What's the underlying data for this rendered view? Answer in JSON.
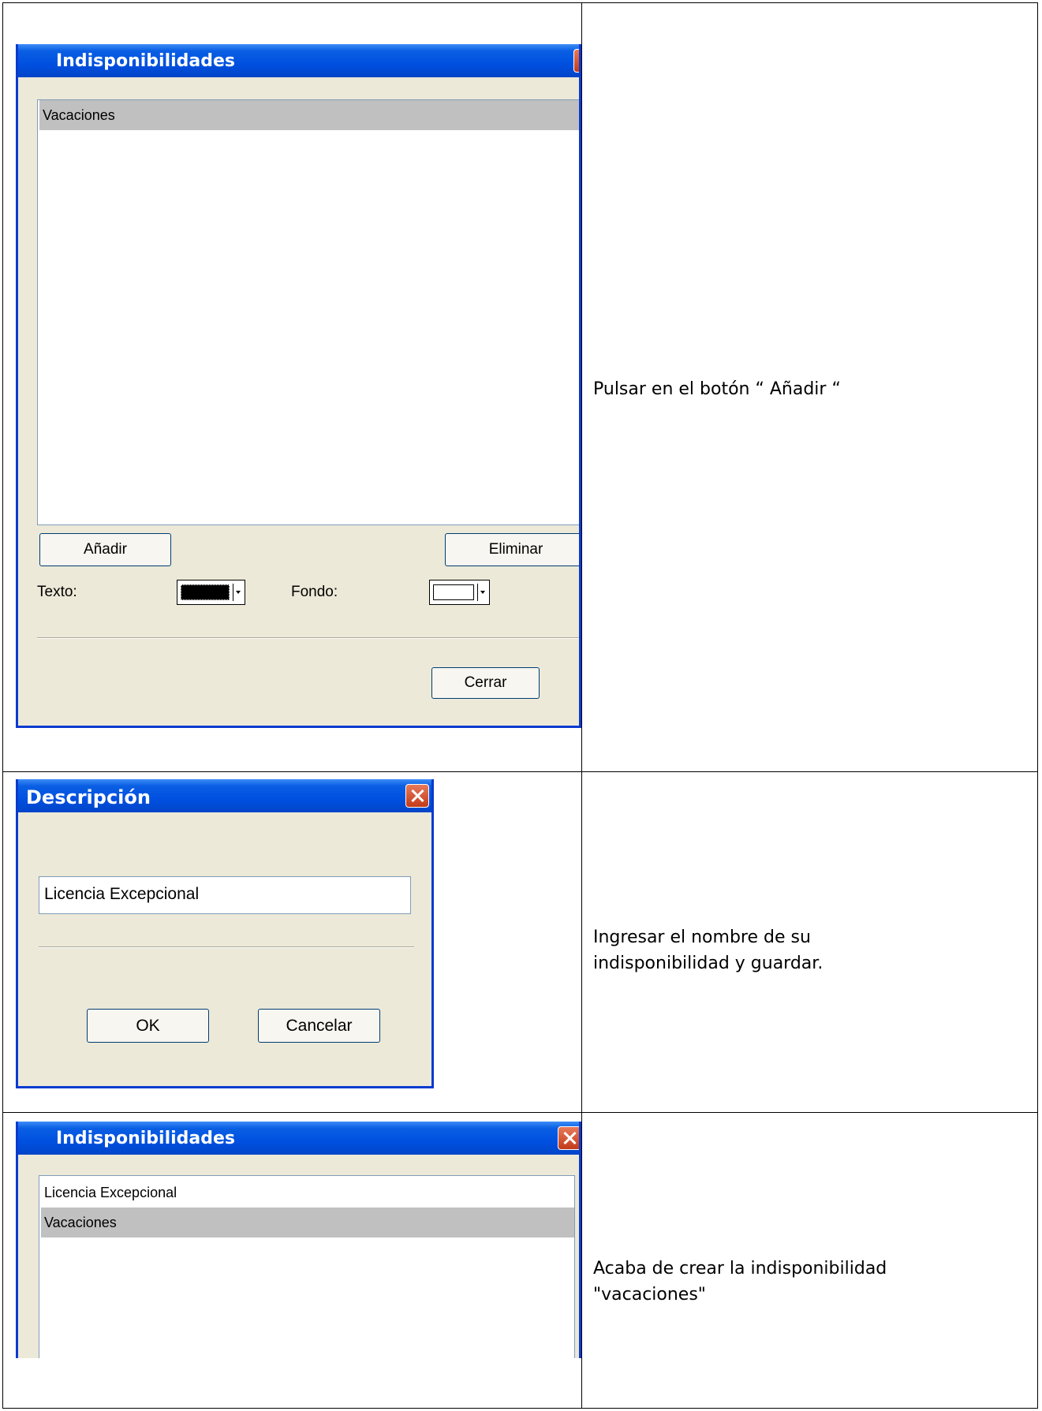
{
  "rows": [
    {
      "dialog": {
        "title": "Indisponibilidades",
        "list_items": [
          {
            "label": "Vacaciones",
            "selected": true
          }
        ],
        "add_label": "Añadir",
        "delete_label": "Eliminar",
        "text_label": "Texto:",
        "background_label": "Fondo:",
        "close_label": "Cerrar"
      },
      "instruction": "Pulsar en el botón “ Añadir “"
    },
    {
      "dialog": {
        "title": "Descripción",
        "input_value": "Licencia Excepcional",
        "ok_label": "OK",
        "cancel_label": "Cancelar"
      },
      "instruction_lines": [
        "Ingresar el nombre de su",
        "indisponibilidad y guardar."
      ]
    },
    {
      "dialog": {
        "title": "Indisponibilidades",
        "list_items": [
          {
            "label": "Licencia Excepcional",
            "selected": false
          },
          {
            "label": "Vacaciones",
            "selected": true
          }
        ]
      },
      "instruction_lines": [
        "Acaba de crear la indisponibilidad",
        "\"vacaciones\""
      ]
    }
  ],
  "colors": {
    "titlebar": "#0050e0",
    "dialog_bg": "#ece9d8",
    "selection": "#c0c0c0",
    "close_button": "#c23b1a"
  }
}
